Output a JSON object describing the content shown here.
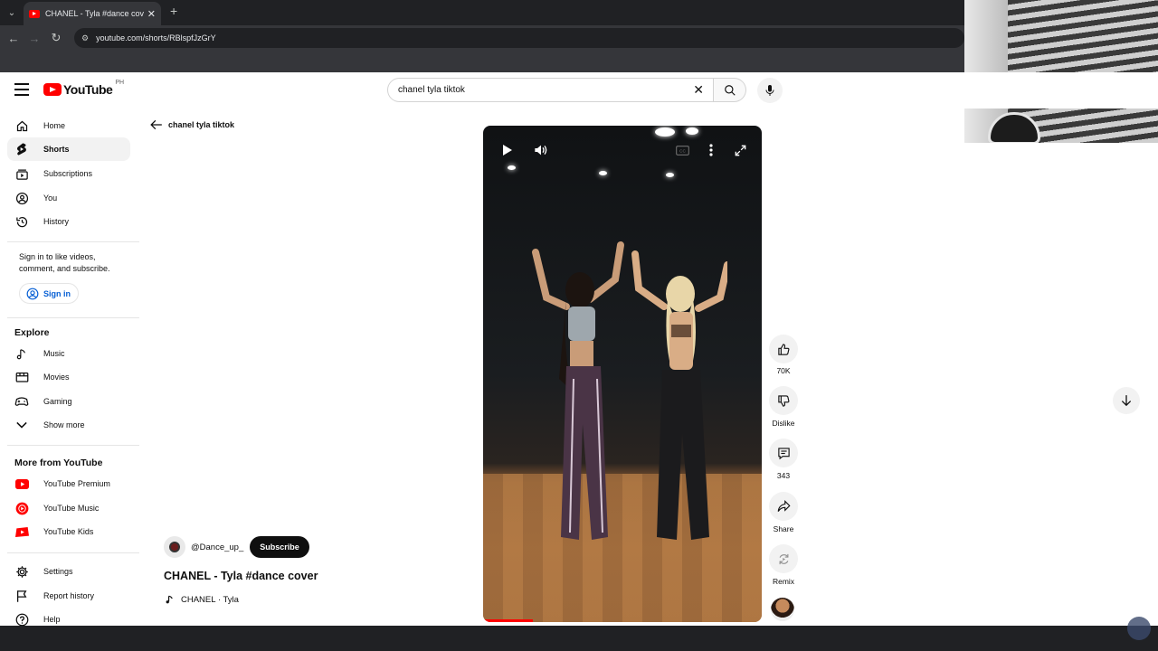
{
  "browser": {
    "tab_title": "CHANEL - Tyla #dance cover - YouTube",
    "url": "youtube.com/shorts/RBlspfJzGrY"
  },
  "header": {
    "logo_text": "YouTube",
    "country_code": "PH",
    "search_query": "chanel tyla tiktok"
  },
  "sidebar": {
    "main_items": [
      {
        "label": "Home",
        "icon": "home-icon"
      },
      {
        "label": "Shorts",
        "icon": "shorts-icon",
        "active": true
      },
      {
        "label": "Subscriptions",
        "icon": "subscriptions-icon"
      },
      {
        "label": "You",
        "icon": "you-icon"
      },
      {
        "label": "History",
        "icon": "history-icon"
      }
    ],
    "signin_prompt": "Sign in to like videos, comment, and subscribe.",
    "signin_label": "Sign in",
    "explore_title": "Explore",
    "explore_items": [
      {
        "label": "Music",
        "icon": "music-icon"
      },
      {
        "label": "Movies",
        "icon": "movies-icon"
      },
      {
        "label": "Gaming",
        "icon": "gaming-icon"
      },
      {
        "label": "Show more",
        "icon": "chevron-down-icon"
      }
    ],
    "more_title": "More from YouTube",
    "more_items": [
      {
        "label": "YouTube Premium",
        "icon": "youtube-premium-icon"
      },
      {
        "label": "YouTube Music",
        "icon": "youtube-music-icon"
      },
      {
        "label": "YouTube Kids",
        "icon": "youtube-kids-icon"
      }
    ],
    "bottom_items": [
      {
        "label": "Settings",
        "icon": "gear-icon"
      },
      {
        "label": "Report history",
        "icon": "flag-icon"
      },
      {
        "label": "Help",
        "icon": "help-icon"
      }
    ]
  },
  "shorts": {
    "back_label": "chanel tyla tiktok",
    "channel_name": "@Dance_up_",
    "subscribe_label": "Subscribe",
    "video_title": "CHANEL - Tyla #dance cover",
    "music": "CHANEL · Tyla",
    "progress": 0.18,
    "actions": [
      {
        "label": "70K",
        "icon": "thumbs-up-icon"
      },
      {
        "label": "Dislike",
        "icon": "thumbs-down-icon"
      },
      {
        "label": "343",
        "icon": "comment-icon"
      },
      {
        "label": "Share",
        "icon": "share-icon"
      },
      {
        "label": "Remix",
        "icon": "remix-icon"
      }
    ]
  },
  "colors": {
    "brand_red": "#ff0000",
    "link_blue": "#065fd4",
    "text": "#0f0f0f"
  }
}
